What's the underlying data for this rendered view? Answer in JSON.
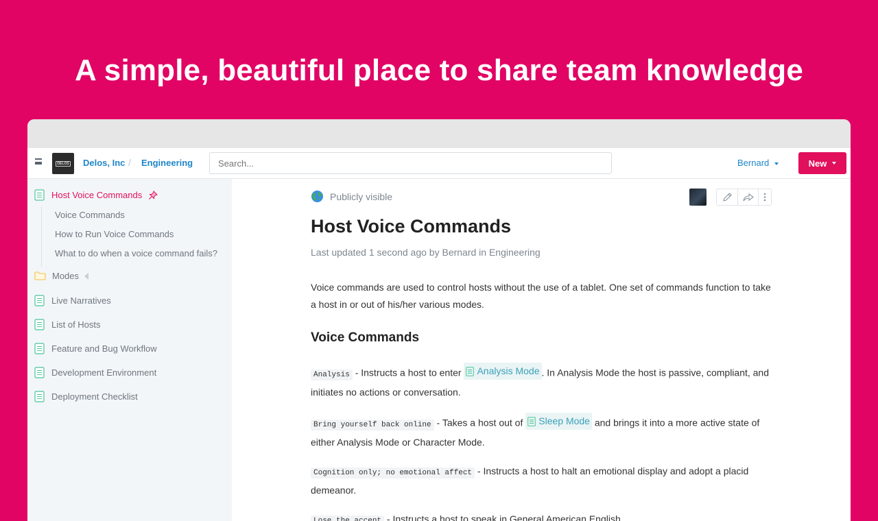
{
  "hero": {
    "title": "A simple, beautiful place to share team knowledge"
  },
  "topbar": {
    "logo_text": "DELOS",
    "org": "Delos, Inc",
    "collection": "Engineering",
    "search_placeholder": "Search...",
    "user": "Bernard",
    "new_label": "New"
  },
  "sidebar": {
    "active": "Host Voice Commands",
    "sub_items": [
      "Voice Commands",
      "How to Run Voice Commands",
      "What to do when a voice command fails?"
    ],
    "folder": "Modes",
    "docs": [
      "Live Narratives",
      "List of Hosts",
      "Feature and Bug Workflow",
      "Development Environment",
      "Deployment Checklist"
    ]
  },
  "doc": {
    "visibility": "Publicly visible",
    "title": "Host Voice Commands",
    "meta": "Last updated 1 second ago by Bernard in Engineering",
    "intro": "Voice commands are used to control hosts without the use of a tablet. One set of commands function to take a host in or out of his/her various modes.",
    "heading": "Voice Commands",
    "cmd1": {
      "code": "Analysis",
      "before": " - Instructs a host to enter ",
      "link": "Analysis Mode",
      "after": ". In Analysis Mode the host is passive, compliant, and initiates no actions or conversation."
    },
    "cmd2": {
      "code": "Bring yourself back online",
      "before": " - Takes a host out of ",
      "link": "Sleep Mode",
      "after": " and brings it into a more active state of either Analysis Mode or Character Mode."
    },
    "cmd3": {
      "code": "Cognition only; no emotional affect",
      "text": " - Instructs a host to halt an emotional display and adopt a placid demeanor."
    },
    "cmd4": {
      "code": "Lose the accent",
      "text": " - Instructs a host to speak in General American English"
    }
  },
  "colors": {
    "brand": "#e10465",
    "accent": "#1f86c8",
    "button": "#e10f5c",
    "sidebar_bg": "#f3f6f8"
  }
}
